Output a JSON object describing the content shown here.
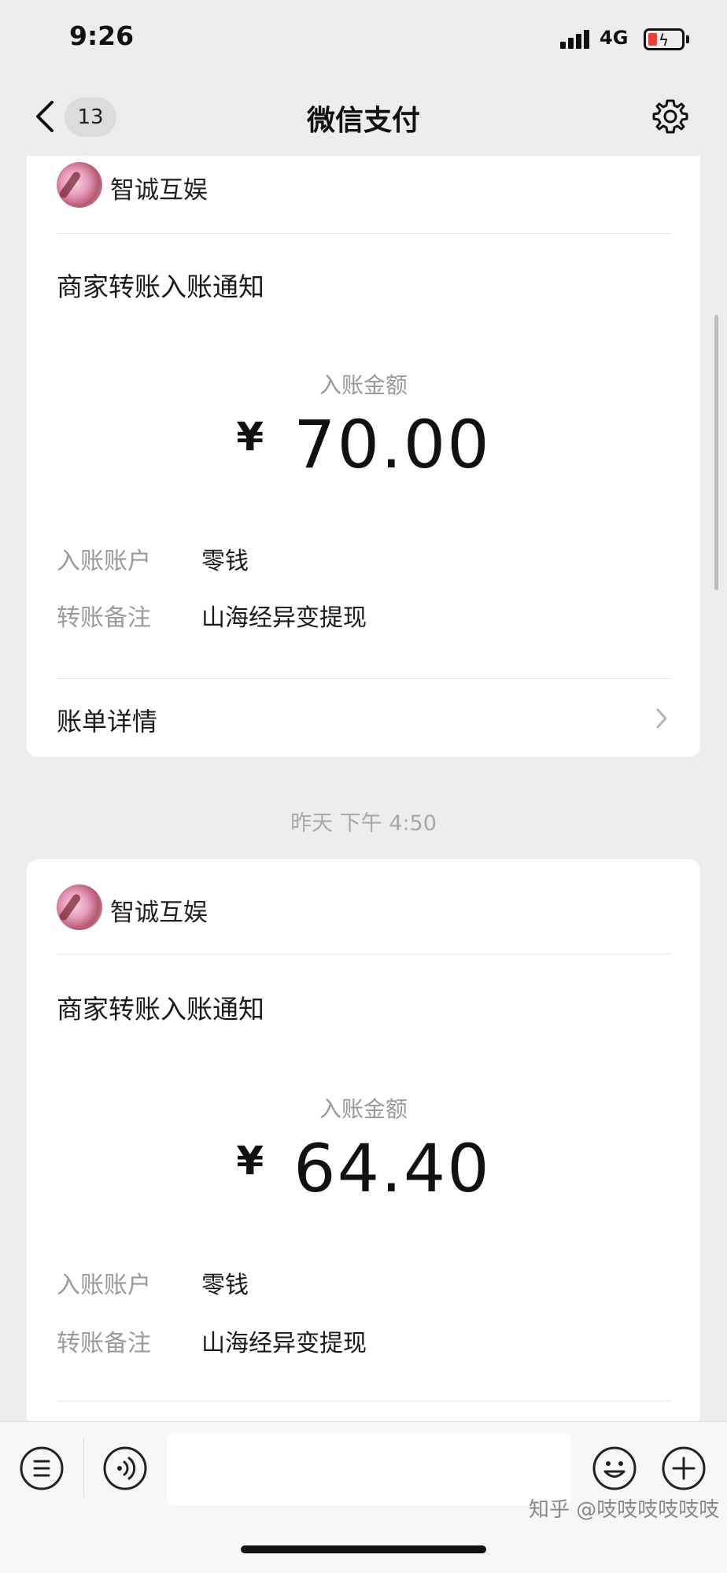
{
  "status_bar": {
    "time": "9:26",
    "network": "4G",
    "battery_charging": true
  },
  "nav": {
    "back_count": "13",
    "title": "微信支付"
  },
  "cards": [
    {
      "merchant": "智诚互娱",
      "notice_title": "商家转账入账通知",
      "amount_label": "入账金额",
      "currency": "¥",
      "amount": "70.00",
      "account_label": "入账账户",
      "account_value": "零钱",
      "remark_label": "转账备注",
      "remark_value": "山海经异变提现",
      "detail_label": "账单详情"
    },
    {
      "merchant": "智诚互娱",
      "notice_title": "商家转账入账通知",
      "amount_label": "入账金额",
      "currency": "¥",
      "amount": "64.40",
      "account_label": "入账账户",
      "account_value": "零钱",
      "remark_label": "转账备注",
      "remark_value": "山海经异变提现"
    }
  ],
  "timestamp": "昨天 下午 4:50",
  "watermark": "知乎 @吱吱吱吱吱吱",
  "icons": [
    "back-chevron-icon",
    "gear-icon",
    "menu-list-icon",
    "voice-icon",
    "emoji-icon",
    "plus-icon",
    "chevron-right-icon"
  ],
  "colors": {
    "background": "#ededed",
    "card": "#ffffff",
    "muted_text": "#9a9a9a",
    "battery_low": "#e8413a"
  }
}
